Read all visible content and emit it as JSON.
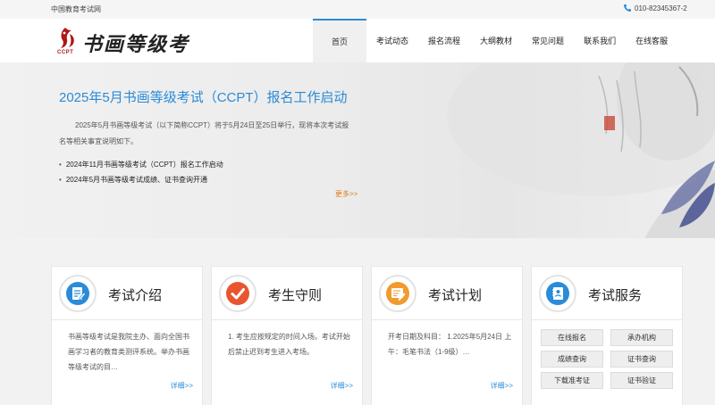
{
  "topbar": {
    "site_name": "中国教育考试网",
    "phone": "010-82345367-2"
  },
  "logo": {
    "mark_text": "CCPT",
    "title": "书画等级考试"
  },
  "nav": [
    "首页",
    "考试动态",
    "报名流程",
    "大纲教材",
    "常见问题",
    "联系我们",
    "在线客服"
  ],
  "banner": {
    "title": "2025年5月书画等级考试（CCPT）报名工作启动",
    "desc": "2025年5月书画等级考试（以下简称CCPT）将于5月24日至25日举行，现将本次考试报名等相关事宜说明如下。",
    "links": [
      "2024年11月书画等级考试（CCPT）报名工作启动",
      "2024年5月书画等级考试成绩、证书查询开通"
    ],
    "more": "更多>>"
  },
  "cards": {
    "intro": {
      "title": "考试介绍",
      "body": "书画等级考试是我院主办、面向全国书画学习者的教育类测评系统。举办书画等级考试的目…",
      "detail": "详细>>"
    },
    "rules": {
      "title": "考生守则",
      "body": "1. 考生应按规定的时间入场。考试开始后禁止迟到考生进入考场。",
      "detail": "详细>>"
    },
    "plan": {
      "title": "考试计划",
      "body": "开考日期及科目： 1.2025年5月24日 上午：毛笔书法（1-9级）…",
      "detail": "详细>>"
    },
    "service": {
      "title": "考试服务",
      "buttons": [
        "在线报名",
        "承办机构",
        "成绩查询",
        "证书查询",
        "下载准考证",
        "证书验证"
      ]
    }
  },
  "colors": {
    "accent": "#2a8bd8",
    "more": "#e07b1a",
    "logo_red": "#b01616"
  }
}
